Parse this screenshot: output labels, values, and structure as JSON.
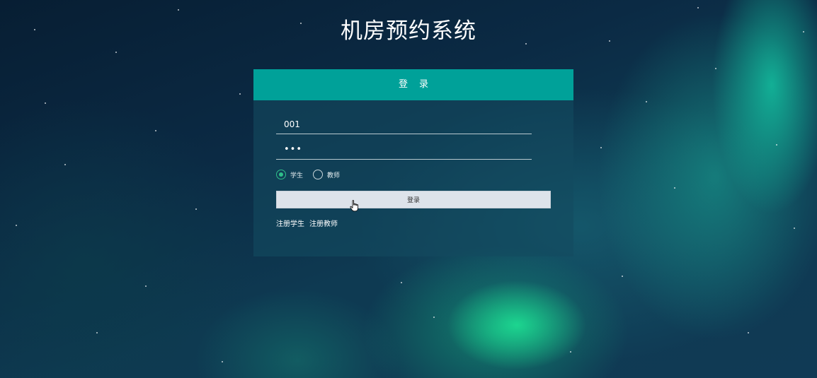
{
  "app": {
    "title": "机房预约系统"
  },
  "login": {
    "header": "登录",
    "username_value": "001",
    "password_value": "•••",
    "roles": [
      {
        "label": "学生",
        "selected": true
      },
      {
        "label": "教师",
        "selected": false
      }
    ],
    "submit_label": "登录",
    "links": {
      "register_student": "注册学生",
      "register_teacher": "注册教师"
    }
  },
  "colors": {
    "header": "#00a199",
    "radio_selected": "#2fbf8a",
    "button": "#dde3ea"
  },
  "icons": {
    "cursor": "hand-pointer-icon"
  }
}
